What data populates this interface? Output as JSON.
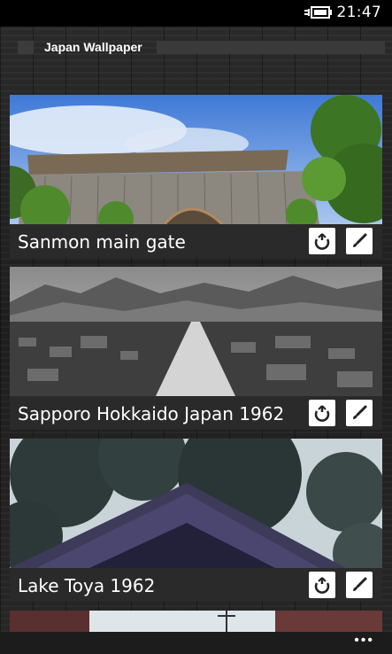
{
  "status_bar": {
    "time": "21:47",
    "icon": "battery-charging-icon"
  },
  "header": {
    "title": "Japan Wallpaper"
  },
  "wallpapers": [
    {
      "title": "Sanmon main gate",
      "share_icon": "share-icon",
      "set_icon": "paintbrush-icon"
    },
    {
      "title": "Sapporo Hokkaido Japan 1962",
      "share_icon": "share-icon",
      "set_icon": "paintbrush-icon"
    },
    {
      "title": "Lake Toya 1962",
      "share_icon": "share-icon",
      "set_icon": "paintbrush-icon"
    }
  ],
  "app_bar": {
    "more_label": "•••"
  },
  "colors": {
    "card_footer": "#2a2a2a",
    "button": "#ffffff",
    "background": "#000000"
  }
}
